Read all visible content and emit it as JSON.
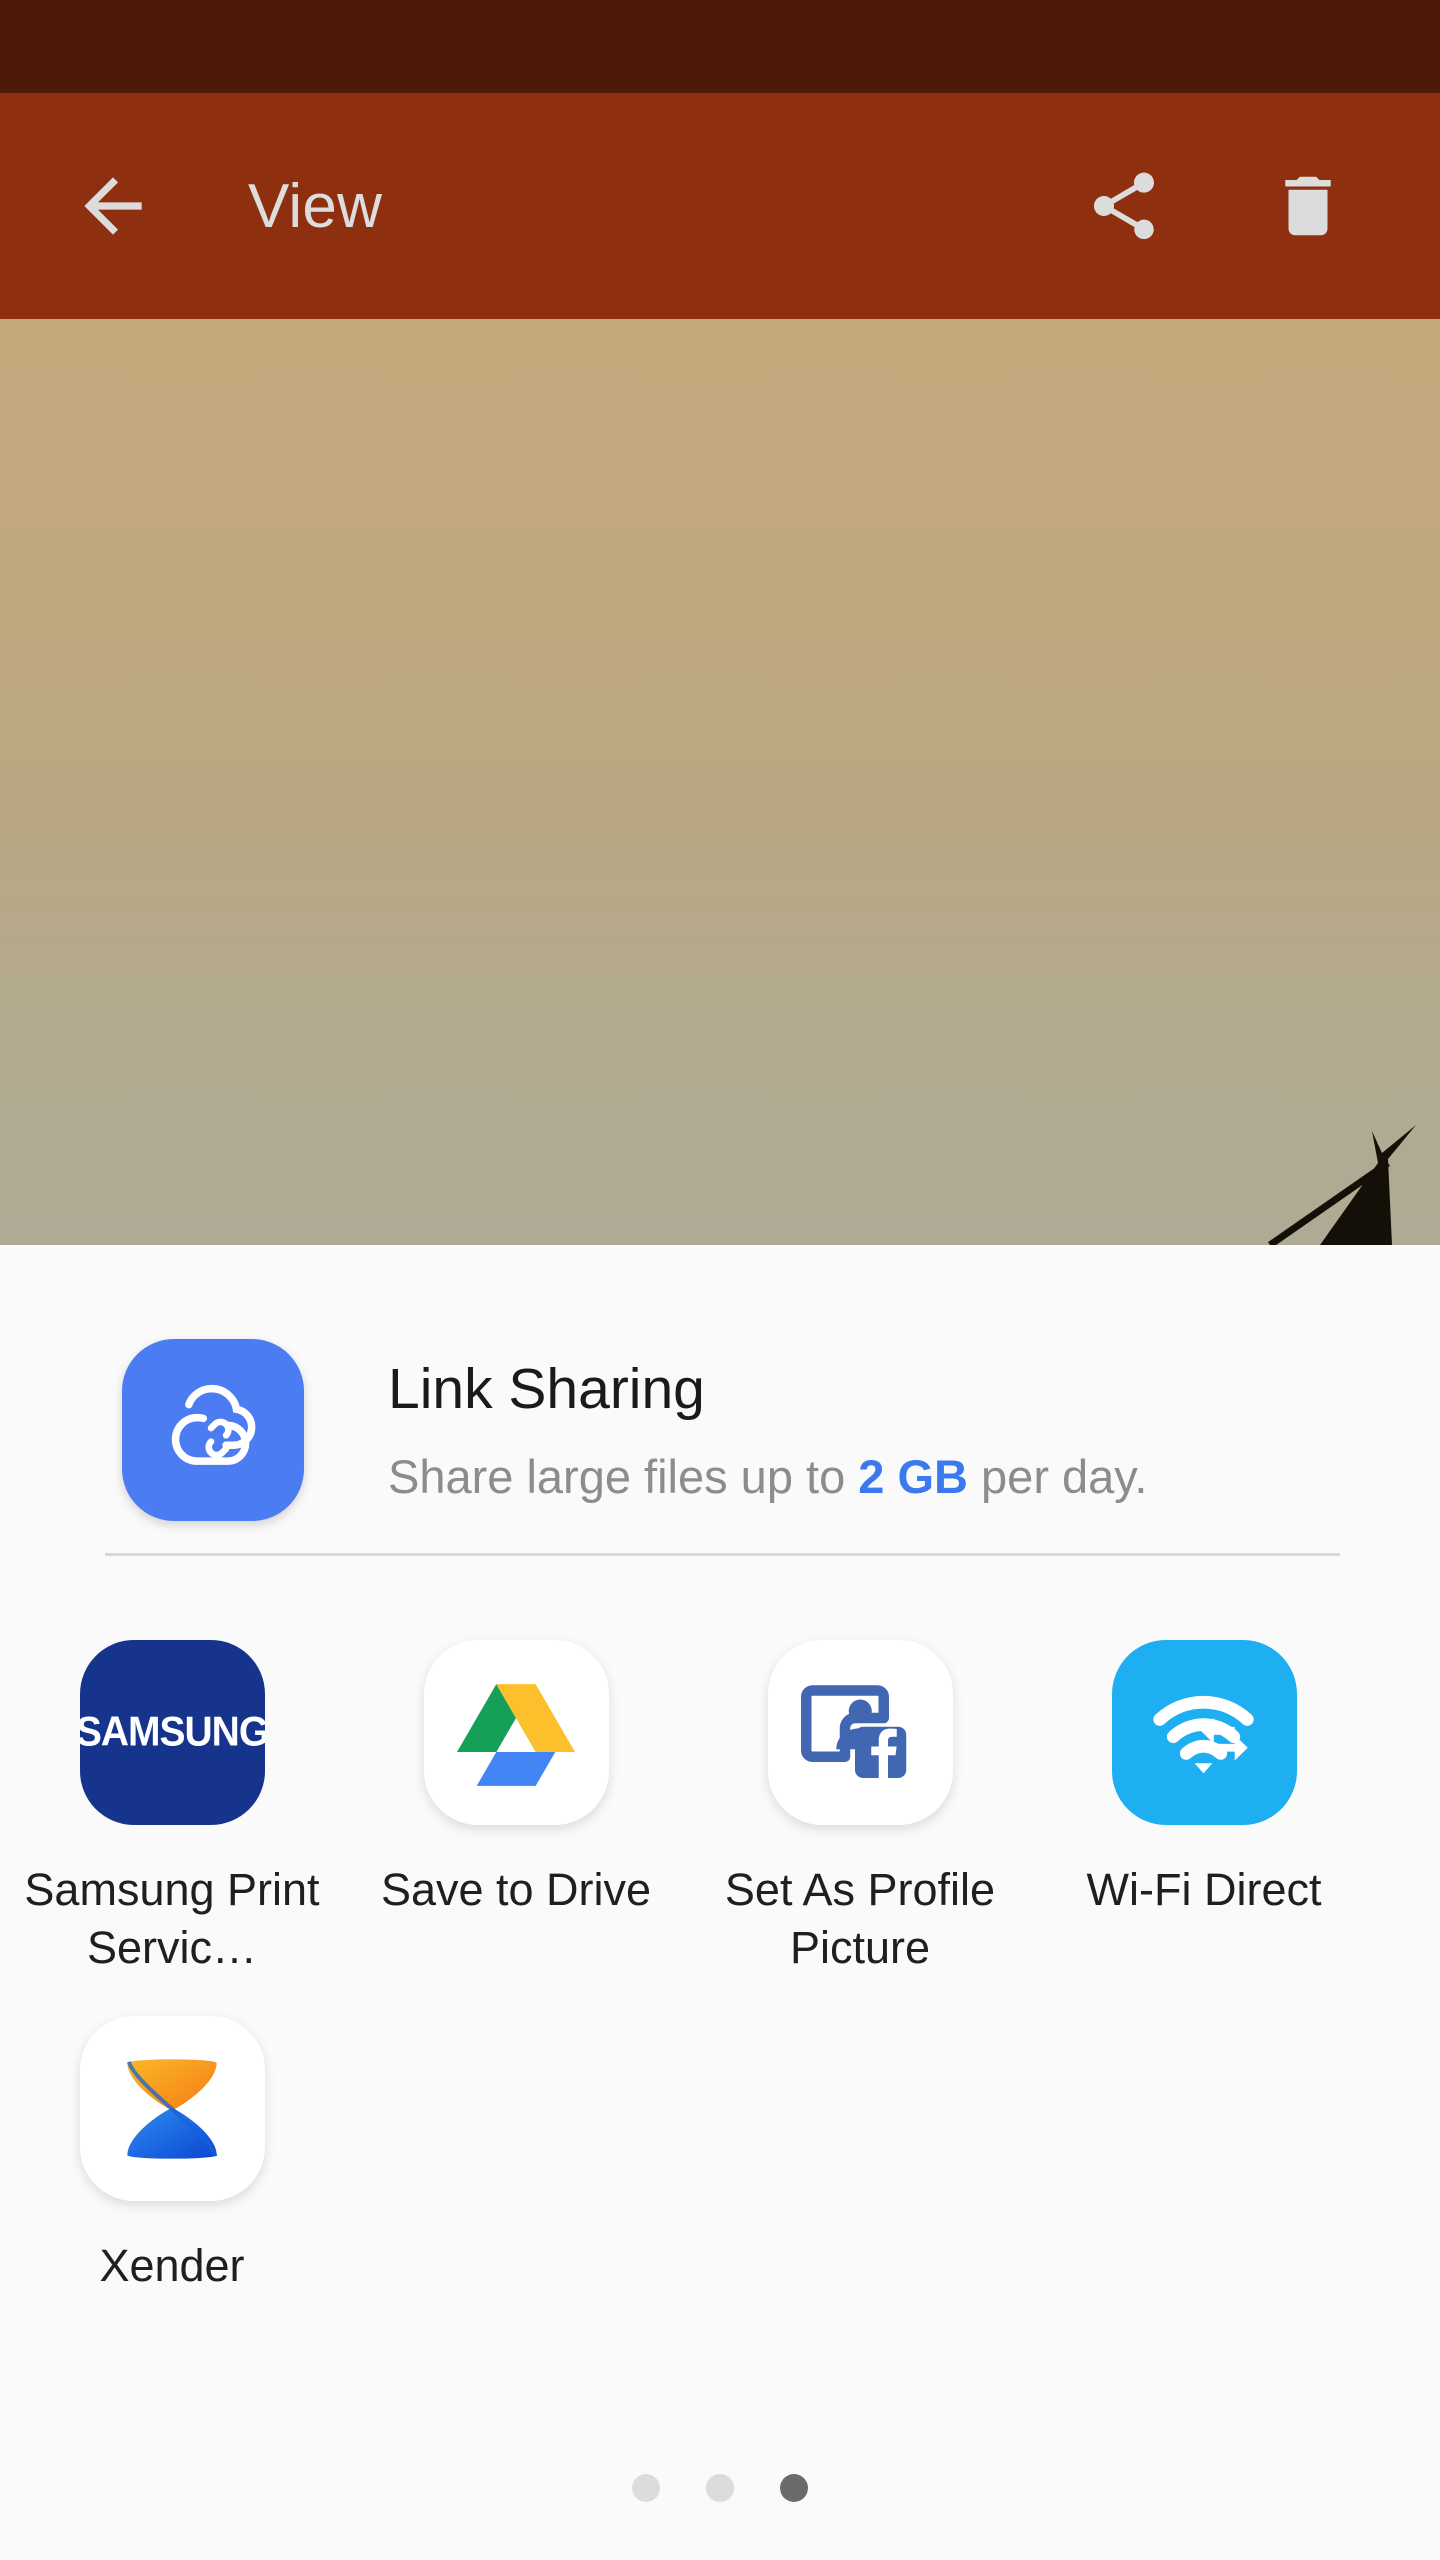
{
  "app_bar": {
    "title": "View",
    "back_icon": "arrow-left-icon",
    "share_icon": "share-icon",
    "delete_icon": "trash-icon"
  },
  "photo": {
    "description": "sky-photo-with-branch",
    "top_color": "#c5a97d",
    "bottom_color": "#aeaa95"
  },
  "share_sheet": {
    "link_sharing": {
      "icon": "cloud-link-icon",
      "icon_color": "#4c7cf2",
      "title": "Link Sharing",
      "subtitle_prefix": "Share large files up to ",
      "subtitle_highlight": "2 GB",
      "subtitle_suffix": " per day.",
      "highlight_color": "#3a79ee"
    },
    "apps": [
      {
        "label": "Samsung Print Servic…",
        "icon": "samsung-print-icon",
        "wordmark": "SAMSUNG",
        "bg": "#16348c"
      },
      {
        "label": "Save to Drive",
        "icon": "google-drive-icon",
        "bg": "#ffffff"
      },
      {
        "label": "Set As Profile Picture",
        "icon": "facebook-profile-picture-icon",
        "bg": "#ffffff"
      },
      {
        "label": "Wi-Fi Direct",
        "icon": "wifi-direct-icon",
        "bg": "#1eaff2"
      },
      {
        "label": "Xender",
        "icon": "xender-icon",
        "bg": "#ffffff"
      }
    ],
    "page_dots": {
      "count": 3,
      "active_index": 2
    }
  },
  "colors": {
    "status_bar": "#4c1a07",
    "app_bar": "#8e300f",
    "sheet_bg": "#fafafa",
    "divider": "#d8d8d8"
  }
}
